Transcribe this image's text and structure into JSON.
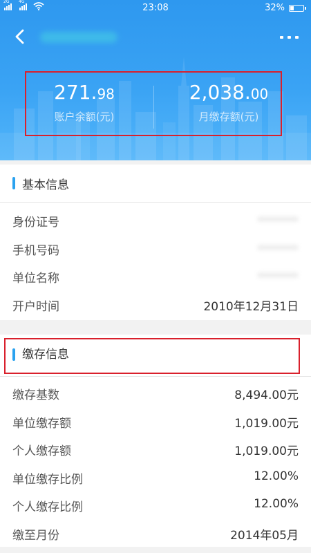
{
  "status_bar": {
    "signal_1_label": "2G",
    "signal_2_label": "4G",
    "time": "23:08",
    "battery_percent": "32%",
    "battery_level": 0.32
  },
  "nav": {
    "back_icon": "chevron-left-icon",
    "more_icon": "more-dots-icon"
  },
  "summary": {
    "balance_int": "271.",
    "balance_dec": "98",
    "balance_label": "账户余额(元)",
    "monthly_int": "2,038.",
    "monthly_dec": "00",
    "monthly_label": "月缴存额(元)"
  },
  "basic_info": {
    "title": "基本信息",
    "rows": [
      {
        "label": "身份证号",
        "value": ""
      },
      {
        "label": "手机号码",
        "value": ""
      },
      {
        "label": "单位名称",
        "value": ""
      },
      {
        "label": "开户时间",
        "value": "2010年12月31日"
      }
    ]
  },
  "payment_info": {
    "title": "缴存信息",
    "rows": [
      {
        "label": "缴存基数",
        "value": "8,494.00元"
      },
      {
        "label": "单位缴存额",
        "value": "1,019.00元"
      },
      {
        "label": "个人缴存额",
        "value": "1,019.00元"
      },
      {
        "label": "单位缴存比例",
        "value": "12.00%"
      },
      {
        "label": "个人缴存比例",
        "value": "12.00%"
      },
      {
        "label": "缴至月份",
        "value": "2014年05月"
      }
    ]
  },
  "colors": {
    "header_blue": "#3aa3f4",
    "accent_bar": "#2aa2ef",
    "highlight_red": "#d9202c"
  }
}
